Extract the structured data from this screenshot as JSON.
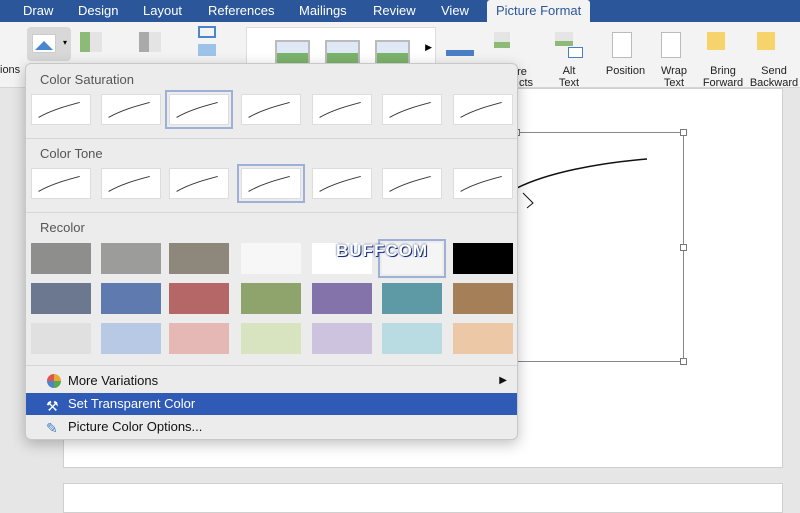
{
  "tabs": [
    {
      "label": "Draw"
    },
    {
      "label": "Design"
    },
    {
      "label": "Layout"
    },
    {
      "label": "References"
    },
    {
      "label": "Mailings"
    },
    {
      "label": "Review"
    },
    {
      "label": "View"
    },
    {
      "label": "Picture Format",
      "active": true
    }
  ],
  "ribbon": {
    "corrections_partial": "ions",
    "effects_partial_1": "ure",
    "effects_partial_2": "cts",
    "alt_text": "Alt Text",
    "position": "Position",
    "wrap_text": "Wrap Text",
    "bring_forward": "Bring Forward",
    "send_backward": "Send Backward"
  },
  "menu": {
    "color_saturation": "Color Saturation",
    "color_tone": "Color Tone",
    "recolor": "Recolor",
    "saturation_selected": 2,
    "tone_selected": 3,
    "recolor_rows": [
      [
        "#8e8e8c",
        "#9c9c9a",
        "#8e877b",
        "#f7f7f7",
        "#ffffff",
        "#f5f5f5",
        "#000000"
      ],
      [
        "#6b7890",
        "#5f7aae",
        "#b46766",
        "#8ea46c",
        "#8472aa",
        "#5e9aa5",
        "#a57f58"
      ],
      [
        "#e0e0e0",
        "#b8c9e6",
        "#e5b8b6",
        "#d8e4c0",
        "#cdc3de",
        "#b9dbe2",
        "#ecc8a6"
      ]
    ],
    "recolor_selected": [
      0,
      5
    ],
    "items": [
      {
        "label": "More Variations",
        "icon": "color-wheel-icon"
      },
      {
        "label": "Set Transparent Color",
        "icon": "magic-wand-icon",
        "highlighted": true
      },
      {
        "label": "Picture Color Options...",
        "icon": "paint-brush-icon"
      }
    ]
  },
  "watermark": "BUFFCOM",
  "colors": {
    "accent": "#2b579a",
    "highlight": "#2f5bb7"
  }
}
